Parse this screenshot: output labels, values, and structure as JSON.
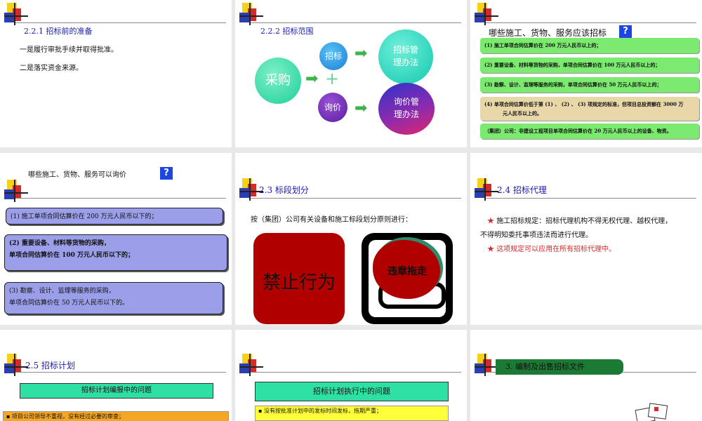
{
  "s1": {
    "title": "2.2.1 招标前的准备",
    "line1": "一是履行审批手续并取得批准。",
    "line2": "二是落实资金来源。"
  },
  "s2": {
    "title": "2.2.2 招标范围",
    "caigou": "采购",
    "zhaobiao": "招标",
    "xunjia": "询价",
    "plus": "+",
    "zb_mgmt_1": "招标管",
    "zb_mgmt_2": "理办法",
    "xj_mgmt_1": "询价管",
    "xj_mgmt_2": "理办法",
    "arrow": "➡"
  },
  "s3": {
    "title": "哪些施工、货物、服务应该招标",
    "qmark": "?",
    "items": [
      "(1) 施工单项合同估算价在 200 万元人民币以上的；",
      "(2) 重要设备、材料等货物的采购，单项合同估算价在 100 万元人民币以上的；",
      "(3) 勘察、设计、监理等服务的采购，单项合同估算价在 50 万元人民币以上的；",
      "(4) 单项合同估算价低于第 (1) 、 (2) 、 (3) 项规定的标准，但项目总投资额在 3000 万",
      "元人民币以上的。",
      "（集团）公司：非建设工程项目单项合同估算价在 20 万元人民币以上的设备、物资。"
    ]
  },
  "s4": {
    "title": "哪些施工、货物、服务可以询价",
    "qmark": "?",
    "b1": "(1) 施工单项合同估算价在 200 万元人民币以下的；",
    "b2_l1": "(2) 重要设备、材料等货物的采购，",
    "b2_l2": "单项合同估算价在 100 万元人民币以下的；",
    "b3_l1": "(3) 勘察、设计、监理等服务的采购，",
    "b3_l2": "单项合同估算价在 50 万元人民币以下的。"
  },
  "s5": {
    "title": "2.3 标段划分",
    "intro": "按（集团）公司有关设备和施工标段划分原则进行：",
    "forbid": "禁止行为",
    "violate": "违章拖走"
  },
  "s6": {
    "title": "2.4 招标代理",
    "star": "★",
    "l1": "施工招标规定：招标代理机构不得无权代理、越权代理，",
    "l2": "不得明知委托事项违法而进行代理。",
    "l3": "这项规定可以应用在所有招标代理中。"
  },
  "s7": {
    "title": "2.5 招标计划",
    "banner": "招标计划编报中的问题",
    "note": "▪ 项目公司领导不重视，没有经过必要的审查；"
  },
  "s8": {
    "banner": "招标计划执行中的问题",
    "note": "▪ 没有按批准计划中的发标时间发标，拖期严重；"
  },
  "s9": {
    "title": "3.  编制及出售招标文件"
  },
  "colors": {
    "title_blue": "#1a1ab0",
    "green_box": "#7bea6f",
    "purple_box": "#9b9ee8",
    "teal": "#2ee0a4",
    "red": "#d42a2a"
  }
}
